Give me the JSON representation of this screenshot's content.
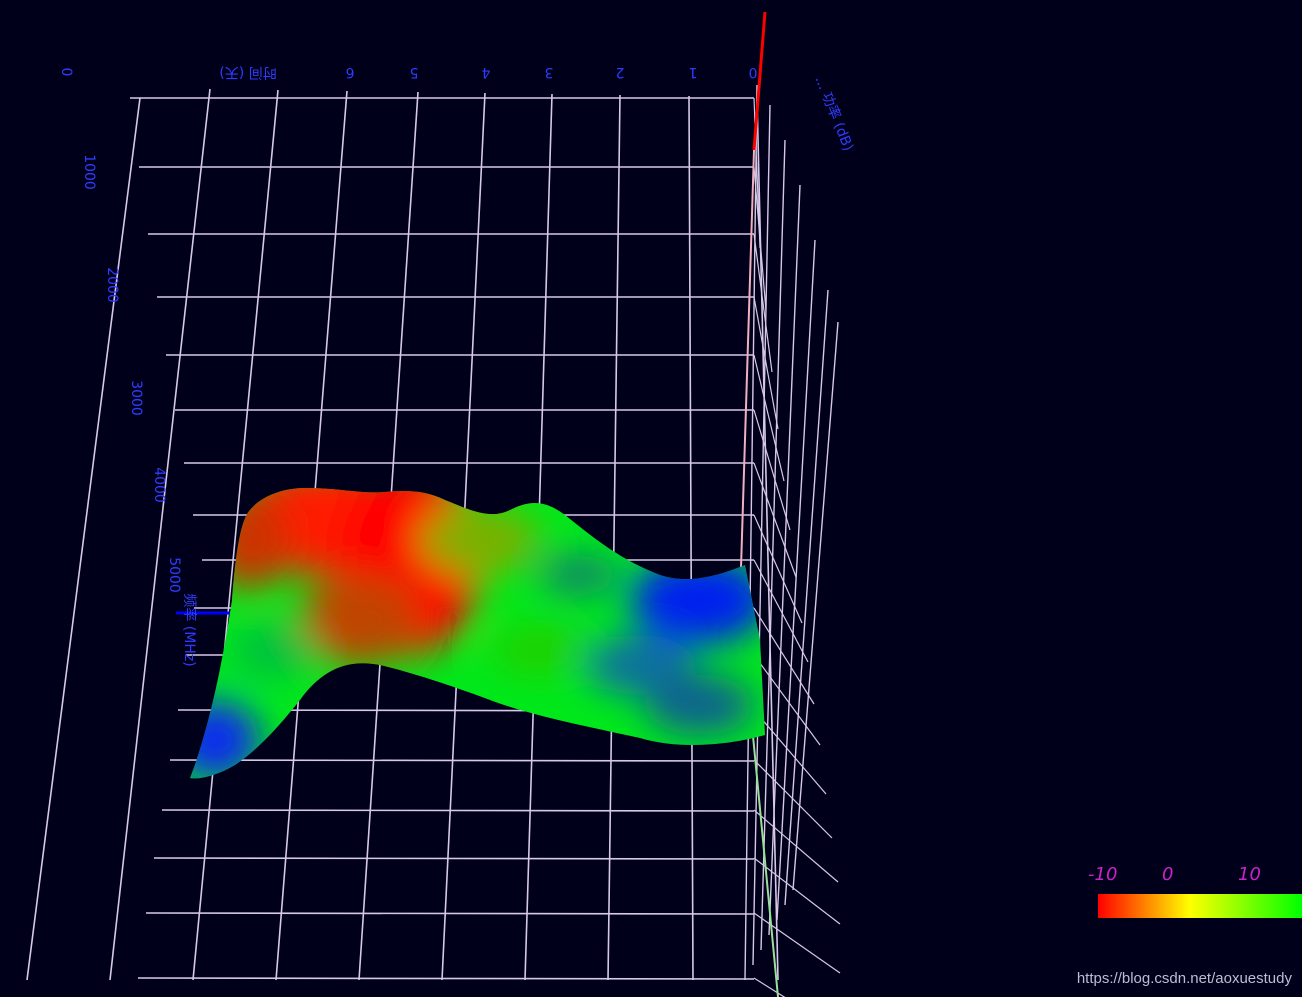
{
  "colors": {
    "background": "#00001a",
    "grid": "#d8c8e8",
    "axis_text": "#2f3cff",
    "colorbar_text": "#cc22cc",
    "surface_low": "#ff0000",
    "surface_mid": "#00ff00",
    "surface_high": "#0022ee",
    "z_axis": "#ff0000",
    "x_axis": "#0000ff"
  },
  "chart_data": {
    "type": "surface3d",
    "xlabel": "时间 (天)",
    "ylabel": "频率 (MHz)",
    "zlabel": "... 功率 (dB)",
    "x_ticks": [
      "0",
      "1",
      "2",
      "3",
      "4",
      "5",
      "6"
    ],
    "y_ticks": [
      "0",
      "1000",
      "2000",
      "3000",
      "4000",
      "5000"
    ],
    "colorbar": {
      "ticks": [
        "-10",
        "0",
        "10"
      ],
      "colors": [
        "#ff0000",
        "#ffff00",
        "#00ff00"
      ]
    },
    "surface_heights": [
      [
        -12,
        -6,
        -2,
        3,
        7,
        11,
        14
      ],
      [
        -4,
        -12,
        -6,
        2,
        6,
        10,
        13
      ],
      [
        2,
        -8,
        -10,
        -1,
        4,
        8,
        12
      ],
      [
        6,
        -2,
        -8,
        2,
        8,
        12,
        14
      ],
      [
        10,
        4,
        -2,
        6,
        11,
        15,
        16
      ],
      [
        14,
        10,
        6,
        10,
        14,
        16,
        15
      ]
    ]
  },
  "watermark": "https://blog.csdn.net/aoxuestudy"
}
